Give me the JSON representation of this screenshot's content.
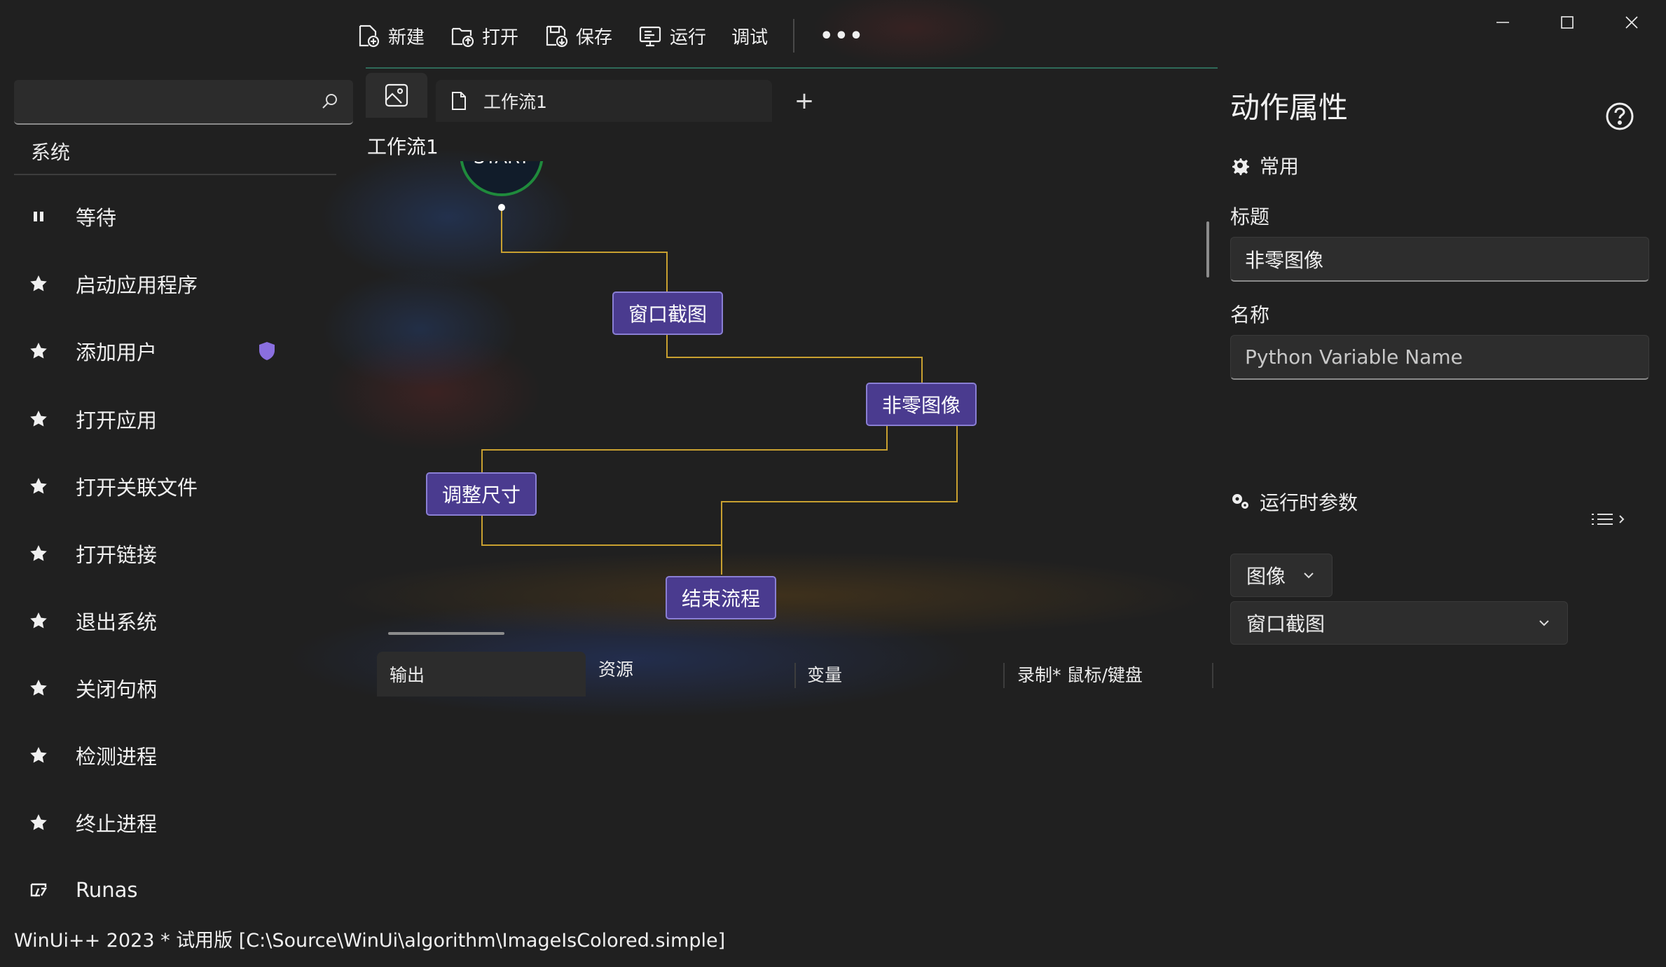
{
  "toolbar": {
    "new_label": "新建",
    "open_label": "打开",
    "save_label": "保存",
    "run_label": "运行",
    "debug_label": "调试",
    "more_label": "•••"
  },
  "sidebar": {
    "search_placeholder": "",
    "category": "系统",
    "items": [
      {
        "label": "等待",
        "icon": "pause-icon"
      },
      {
        "label": "启动应用程序",
        "icon": "star-icon"
      },
      {
        "label": "添加用户",
        "icon": "star-icon",
        "badge": "shield-icon"
      },
      {
        "label": "打开应用",
        "icon": "star-icon"
      },
      {
        "label": "打开关联文件",
        "icon": "star-icon"
      },
      {
        "label": "打开链接",
        "icon": "star-icon"
      },
      {
        "label": "退出系统",
        "icon": "star-icon"
      },
      {
        "label": "关闭句柄",
        "icon": "star-icon"
      },
      {
        "label": "检测进程",
        "icon": "star-icon"
      },
      {
        "label": "终止进程",
        "icon": "star-icon"
      },
      {
        "label": "Runas",
        "icon": "runas-icon"
      }
    ]
  },
  "tabs": {
    "doc_tab_label": "工作流1",
    "add_label": "+"
  },
  "workflow": {
    "title": "工作流1",
    "start_label": "START",
    "nodes": {
      "capture": "窗口截图",
      "nonzero": "非零图像",
      "resize": "调整尺寸",
      "end": "结束流程"
    }
  },
  "bottom_tabs": {
    "output": "输出",
    "resources": "资源",
    "variables": "变量",
    "record": "录制* 鼠标/键盘"
  },
  "properties": {
    "title": "动作属性",
    "common_section": "常用",
    "caption_label": "标题",
    "caption_value": "非零图像",
    "name_label": "名称",
    "name_placeholder": "Python Variable Name",
    "runtime_section": "运行时参数",
    "param_type": "图像",
    "param_value": "窗口截图"
  },
  "status_bar": {
    "text": "WinUi++ 2023 * 试用版 [C:\\Source\\WinUi\\algorithm\\ImageIsColored.simple]"
  },
  "colors": {
    "node_fill": "#4a3b8f",
    "connector": "#c8a030",
    "start_ring": "#1f8a3c",
    "shield_badge": "#8a6fe0"
  }
}
